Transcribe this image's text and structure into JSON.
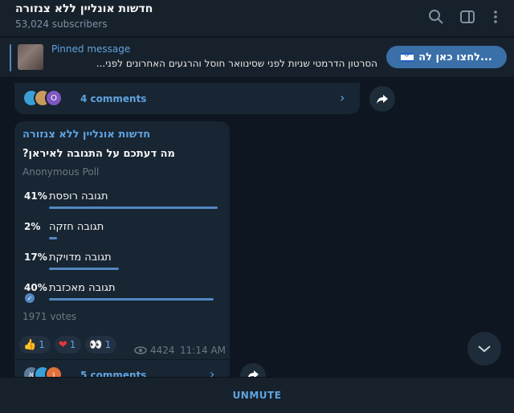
{
  "header": {
    "title": "חדשות אונליין ללא צנזורה",
    "subscribers": "53,024 subscribers",
    "icons": [
      "search-icon",
      "sidebar-toggle-icon",
      "more-icon"
    ]
  },
  "pinned": {
    "label": "Pinned message",
    "text": "הסרטון הדרמטי שניות לפני שסינוואר חוסל והרגעים האחרונים לפני...",
    "button_label": "לחצו כאן לה..."
  },
  "prev_message": {
    "comments_label": "4 comments",
    "avatars": [
      "",
      "",
      "O"
    ]
  },
  "poll": {
    "author": "חדשות אונליין ללא צנזורה",
    "question": "מה דעתכם על התגובה לאיראן?",
    "type": "Anonymous Poll",
    "options": [
      {
        "label": "תגובה רופסת",
        "percent": "41%",
        "fraction": 0.41,
        "voted": false
      },
      {
        "label": "תגובה חזקה",
        "percent": "2%",
        "fraction": 0.02,
        "voted": false
      },
      {
        "label": "תגובה מדויקת",
        "percent": "17%",
        "fraction": 0.17,
        "voted": false
      },
      {
        "label": "תגובה מאכזבת",
        "percent": "40%",
        "fraction": 0.4,
        "voted": true
      }
    ],
    "votes": "1971 votes",
    "reactions": [
      {
        "emoji": "👍",
        "count": "1"
      },
      {
        "emoji": "❤",
        "count": "1"
      },
      {
        "emoji": "👀",
        "count": "1"
      }
    ],
    "views": "4424",
    "time": "11:14 AM",
    "comments_label": "5 comments",
    "avatars": [
      "א",
      "",
      "ו"
    ]
  },
  "bottom": {
    "unmute_label": "UNMUTE"
  },
  "colors": {
    "accent": "#5fa3de",
    "bar": "#5288c1",
    "background": "#0e1621",
    "card": "#182533"
  }
}
